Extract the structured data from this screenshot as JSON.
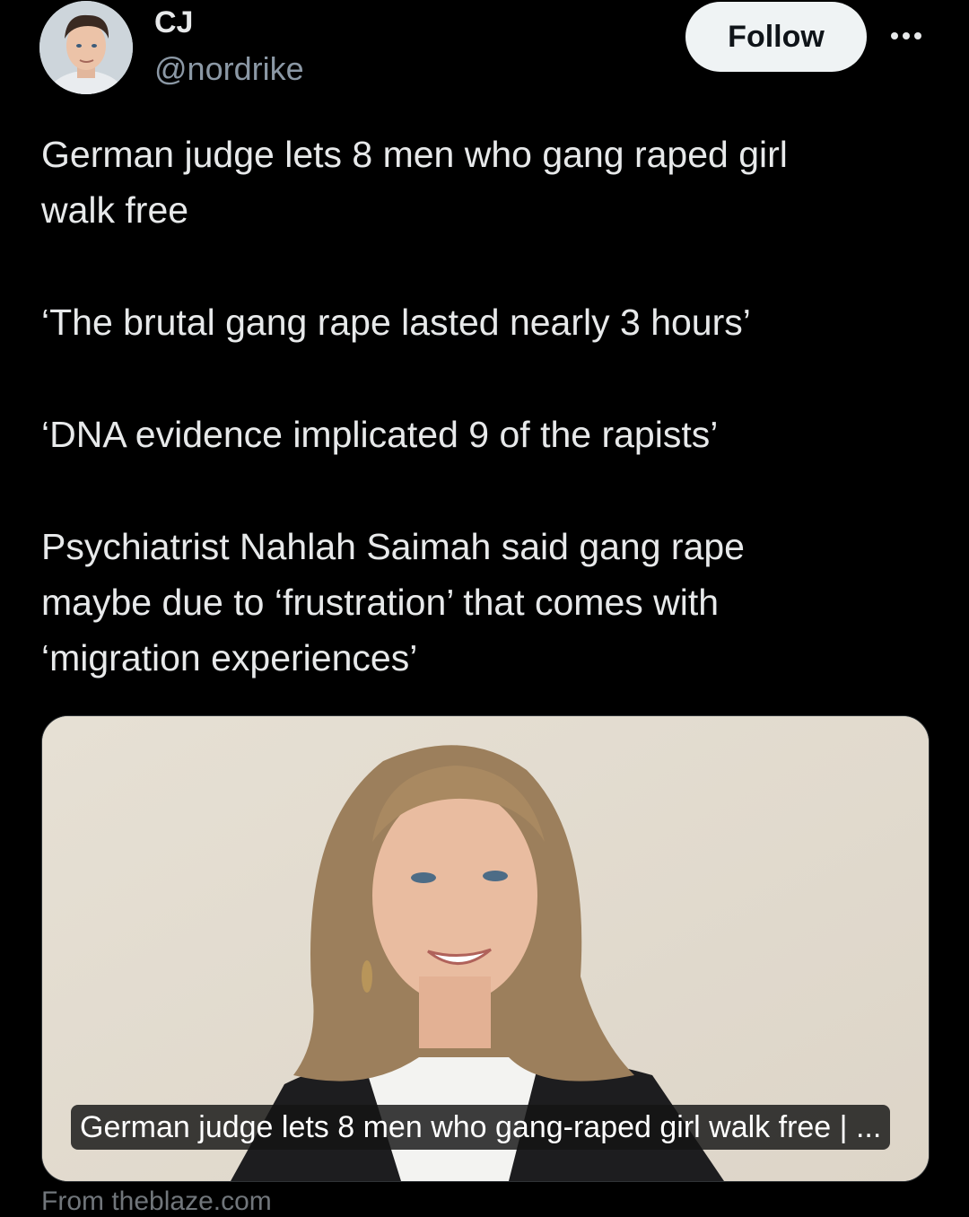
{
  "author": {
    "display_name": "CJ",
    "handle": "@nordrike"
  },
  "actions": {
    "follow_label": "Follow",
    "more_icon": "more-horizontal-icon"
  },
  "post": {
    "paragraphs": [
      "German judge lets 8 men who gang raped girl\nwalk free",
      "‘The brutal gang rape lasted nearly 3 hours’",
      "‘DNA evidence implicated 9 of the rapists’",
      "Psychiatrist Nahlah Saimah said gang rape\nmaybe due to ‘frustration’ that comes with\n‘migration experiences’"
    ]
  },
  "link_card": {
    "caption": "German judge lets 8 men who gang-raped girl walk free | ...",
    "source": "From theblaze.com"
  },
  "colors": {
    "background": "#000000",
    "text": "#e7e9ea",
    "muted": "#71767b",
    "follow_bg": "#eff3f4"
  }
}
